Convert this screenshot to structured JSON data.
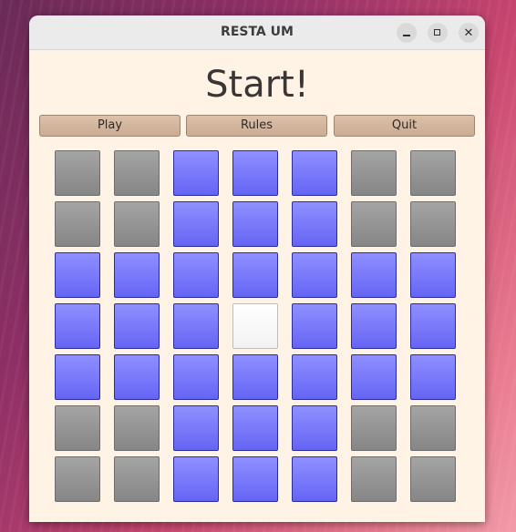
{
  "window": {
    "title": "RESTA UM",
    "controls": {
      "minimize": "minimize-icon",
      "maximize": "maximize-icon",
      "close": "close-icon"
    }
  },
  "status_text": "Start!",
  "menu": {
    "play_label": "Play",
    "rules_label": "Rules",
    "quit_label": "Quit"
  },
  "colors": {
    "peg": "#7b7bff",
    "blocked": "#969696",
    "empty": "#ffffff",
    "background": "#fff3e6",
    "button": "#d4b69d"
  },
  "board": {
    "rows": 7,
    "cols": 7,
    "legend": {
      "X": "blocked",
      "P": "peg",
      "O": "empty"
    },
    "cells": [
      [
        "X",
        "X",
        "P",
        "P",
        "P",
        "X",
        "X"
      ],
      [
        "X",
        "X",
        "P",
        "P",
        "P",
        "X",
        "X"
      ],
      [
        "P",
        "P",
        "P",
        "P",
        "P",
        "P",
        "P"
      ],
      [
        "P",
        "P",
        "P",
        "O",
        "P",
        "P",
        "P"
      ],
      [
        "P",
        "P",
        "P",
        "P",
        "P",
        "P",
        "P"
      ],
      [
        "X",
        "X",
        "P",
        "P",
        "P",
        "X",
        "X"
      ],
      [
        "X",
        "X",
        "P",
        "P",
        "P",
        "X",
        "X"
      ]
    ]
  }
}
